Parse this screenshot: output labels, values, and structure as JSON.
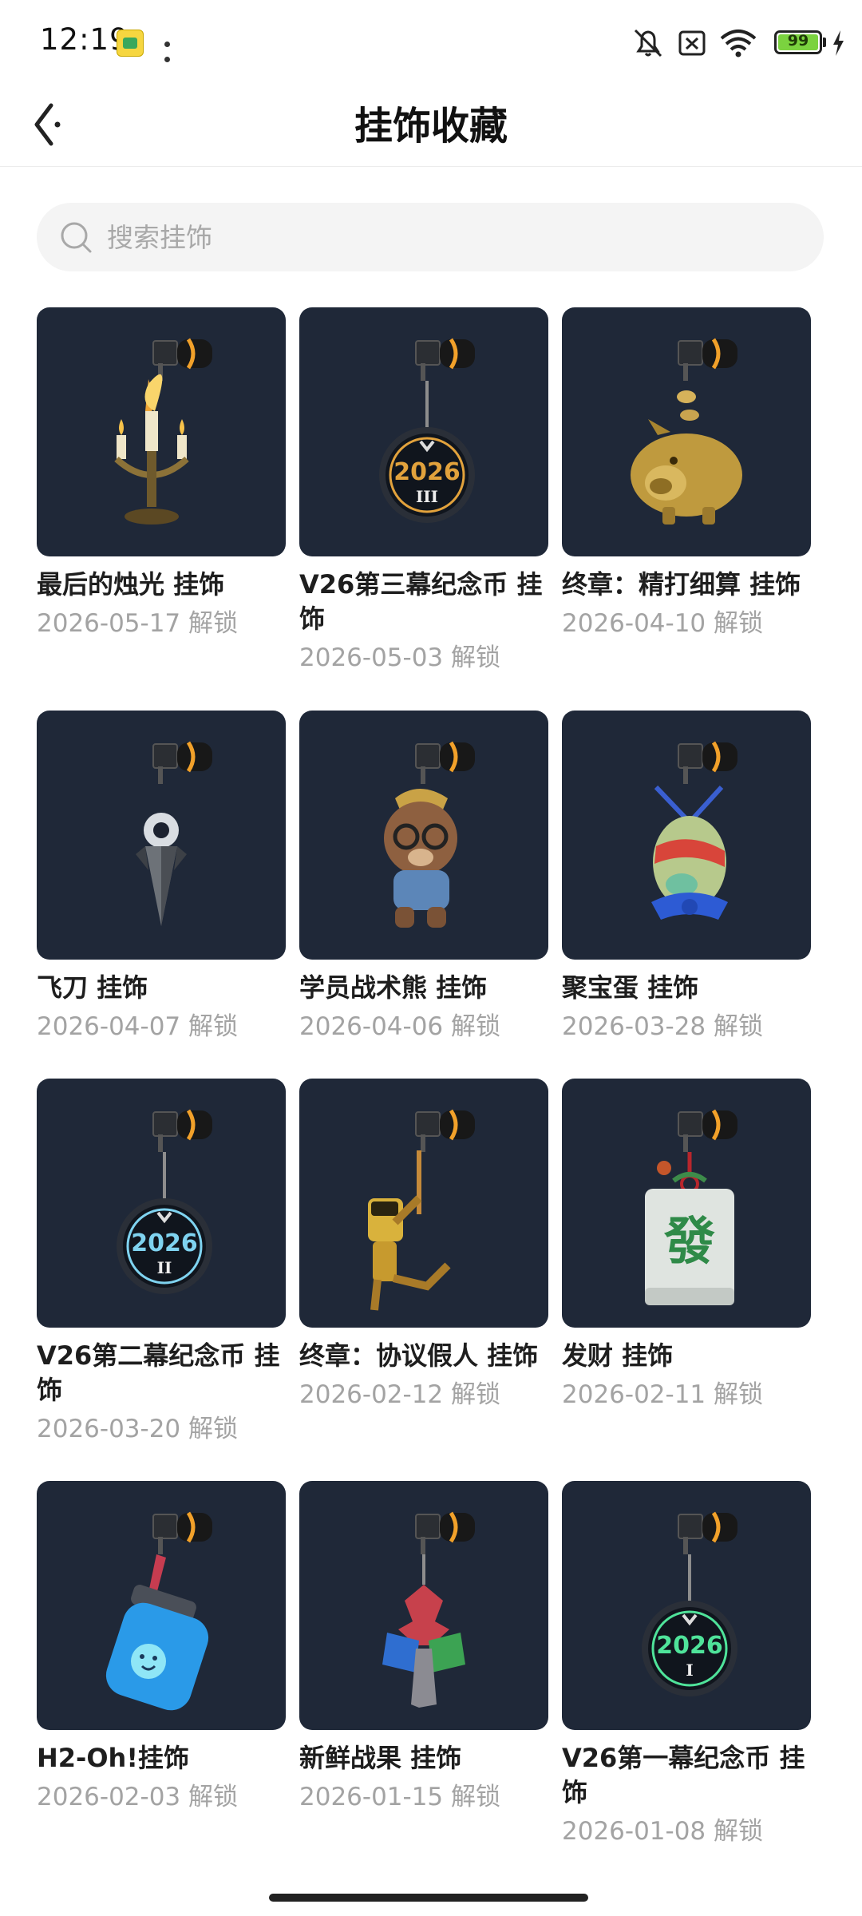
{
  "status_bar": {
    "time": "12:19",
    "battery": "99",
    "icons": [
      "app-icon",
      "more-dots-icon",
      "mute-icon",
      "no-sim-icon",
      "wifi-icon",
      "battery-icon",
      "charging-icon"
    ]
  },
  "header": {
    "title": "挂饰收藏",
    "back_icon": "chevron-left-icon"
  },
  "search": {
    "placeholder": "搜索挂饰",
    "value": "",
    "icon": "search-icon"
  },
  "items": [
    {
      "title": "最后的烛光 挂饰",
      "date": "2026-05-17 解锁",
      "art": "candelabra"
    },
    {
      "title": "V26第三幕纪念币 挂饰",
      "date": "2026-05-03 解锁",
      "art": "coin",
      "coin_text": "2026",
      "coin_sub": "III",
      "coin_color": "#e2a23c"
    },
    {
      "title": "终章：精打细算 挂饰",
      "date": "2026-04-10 解锁",
      "art": "piggy"
    },
    {
      "title": "飞刀 挂饰",
      "date": "2026-04-07 解锁",
      "art": "knife"
    },
    {
      "title": "学员战术熊 挂饰",
      "date": "2026-04-06 解锁",
      "art": "bear"
    },
    {
      "title": "聚宝蛋 挂饰",
      "date": "2026-03-28 解锁",
      "art": "egg"
    },
    {
      "title": "V26第二幕纪念币 挂饰",
      "date": "2026-03-20 解锁",
      "art": "coin",
      "coin_text": "2026",
      "coin_sub": "II",
      "coin_color": "#7fd3f0"
    },
    {
      "title": "终章：协议假人 挂饰",
      "date": "2026-02-12 解锁",
      "art": "dummy"
    },
    {
      "title": "发财 挂饰",
      "date": "2026-02-11 解锁",
      "art": "mahjong",
      "tile_text": "發"
    },
    {
      "title": "H2-Oh!挂饰",
      "date": "2026-02-03 解锁",
      "art": "bottle"
    },
    {
      "title": "新鲜战果 挂饰",
      "date": "2026-01-15 解锁",
      "art": "tree"
    },
    {
      "title": "V26第一幕纪念币 挂饰",
      "date": "2026-01-08 解锁",
      "art": "coin",
      "coin_text": "2026",
      "coin_sub": "I",
      "coin_color": "#4fe39a"
    }
  ],
  "colors": {
    "card_background": "#1f2838",
    "title_text": "#1e1e1e",
    "date_text": "#a3a3a3",
    "search_background": "#f4f4f4"
  }
}
